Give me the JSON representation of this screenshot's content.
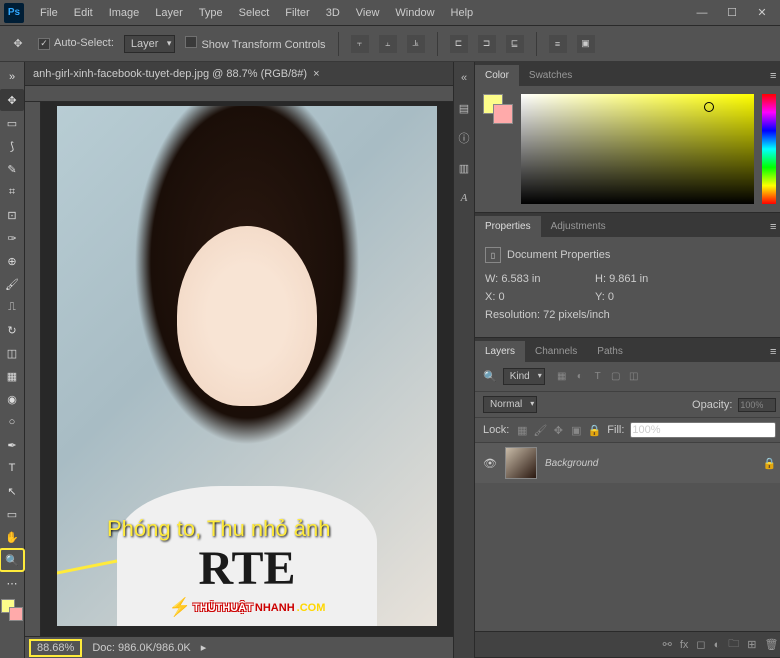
{
  "menubar": {
    "logo": "Ps",
    "items": [
      "File",
      "Edit",
      "Image",
      "Layer",
      "Type",
      "Select",
      "Filter",
      "3D",
      "View",
      "Window",
      "Help"
    ]
  },
  "optbar": {
    "auto_select_label": "Auto-Select:",
    "auto_select_value": "Layer",
    "show_transform_label": "Show Transform Controls"
  },
  "doc_tab": {
    "title": "anh-girl-xinh-facebook-tuyet-dep.jpg @ 88.7% (RGB/8#)",
    "close": "×"
  },
  "canvas": {
    "shirt_text": "RTE",
    "annotation": "Phóng to, Thu nhỏ ảnh",
    "watermark_t1": "THỦTHUẬT",
    "watermark_t2": "NHANH",
    "watermark_t3": ".COM"
  },
  "statusbar": {
    "zoom": "88.68%",
    "doc_info": "Doc: 986.0K/986.0K"
  },
  "panels": {
    "color": {
      "tabs": [
        "Color",
        "Swatches"
      ],
      "fg": "#fdfd8a",
      "bg": "#faa"
    },
    "properties": {
      "tabs": [
        "Properties",
        "Adjustments"
      ],
      "title": "Document Properties",
      "w_label": "W:",
      "w_value": "6.583 in",
      "h_label": "H:",
      "h_value": "9.861 in",
      "x_label": "X:",
      "x_value": "0",
      "y_label": "Y:",
      "y_value": "0",
      "res_label": "Resolution:",
      "res_value": "72 pixels/inch"
    },
    "layers": {
      "tabs": [
        "Layers",
        "Channels",
        "Paths"
      ],
      "kind_label": "Kind",
      "blend_mode": "Normal",
      "opacity_label": "Opacity:",
      "opacity_value": "100%",
      "lock_label": "Lock:",
      "fill_label": "Fill:",
      "fill_value": "100%",
      "layer_name": "Background"
    }
  }
}
